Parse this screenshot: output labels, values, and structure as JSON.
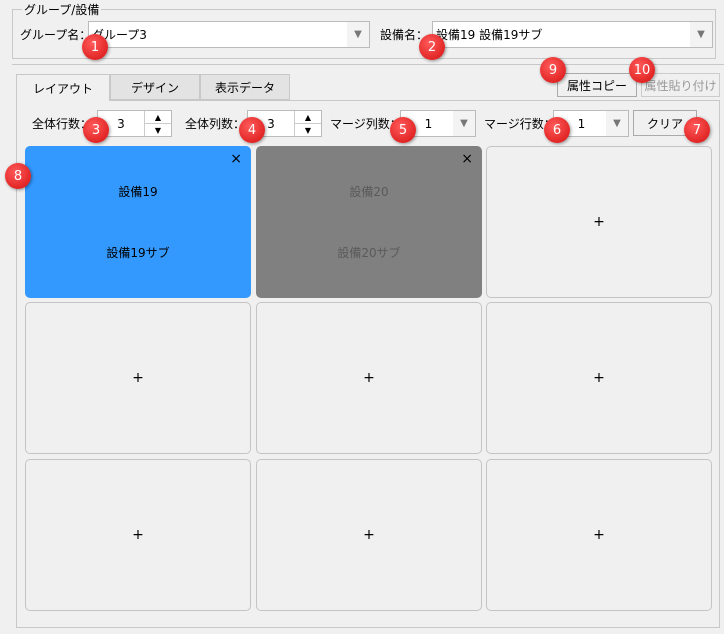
{
  "group_box": {
    "title": "グループ/設備",
    "group_label": "グループ名：",
    "group_value": "グループ3",
    "equipment_label": "設備名：",
    "equipment_value": "設備19 設備19サブ"
  },
  "tabs": [
    {
      "label": "レイアウト",
      "active": true
    },
    {
      "label": "デザイン"
    },
    {
      "label": "表示データ"
    }
  ],
  "buttons": {
    "copy": "属性コピー",
    "paste": "属性貼り付け",
    "clear": "クリア"
  },
  "controls": {
    "rows_label": "全体行数：",
    "rows_value": "3",
    "cols_label": "全体列数：",
    "cols_value": "3",
    "merge_cols_label": "マージ列数：",
    "merge_cols_value": "1",
    "merge_rows_label": "マージ行数：",
    "merge_rows_value": "1"
  },
  "cells": [
    {
      "state": "selected",
      "line1": "設備19",
      "line2": "設備19サブ",
      "close": "×"
    },
    {
      "state": "disabled",
      "line1": "設備20",
      "line2": "設備20サブ",
      "close": "×"
    },
    {
      "state": "empty",
      "add": "+"
    },
    {
      "state": "empty",
      "add": "+"
    },
    {
      "state": "empty",
      "add": "+"
    },
    {
      "state": "empty",
      "add": "+"
    },
    {
      "state": "empty",
      "add": "+"
    },
    {
      "state": "empty",
      "add": "+"
    },
    {
      "state": "empty",
      "add": "+"
    }
  ],
  "badges": [
    "1",
    "2",
    "3",
    "4",
    "5",
    "6",
    "7",
    "8",
    "9",
    "10"
  ],
  "colors": {
    "selected": "#3399ff",
    "disabled": "#808080",
    "badge": "#e02020"
  }
}
